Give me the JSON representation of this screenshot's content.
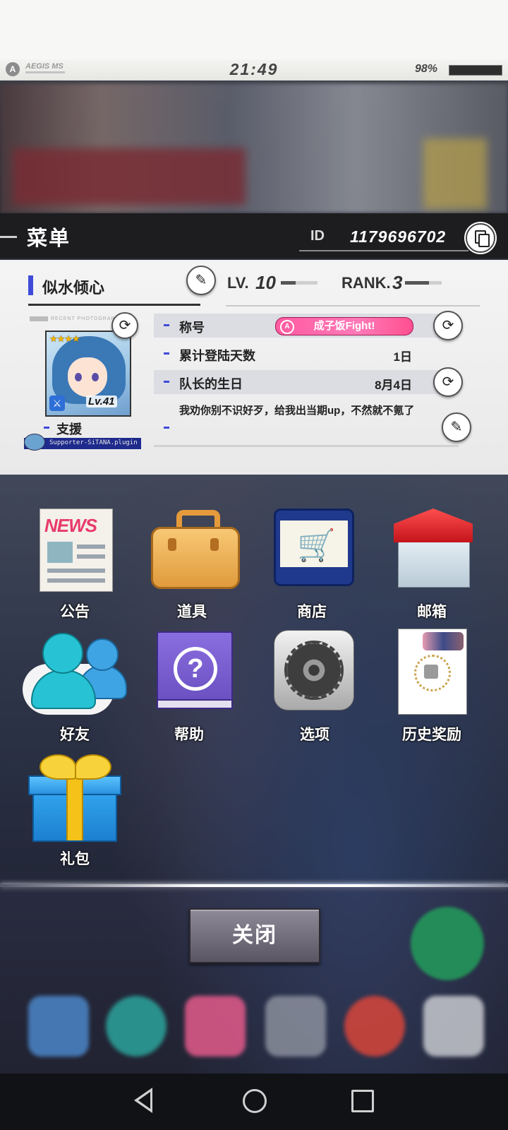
{
  "status_bar": {
    "brand": "AEGIS MS",
    "clock": "21:49",
    "battery": "98%"
  },
  "header": {
    "title": "菜单",
    "id_label": "ID",
    "id_value": "1179696702"
  },
  "profile": {
    "player_name": "似水倾心",
    "lv_label": "LV.",
    "lv_value": "10",
    "rank_label": "RANK.",
    "rank_value": "3",
    "recent_label": "RECENT PHOTOGRAPH",
    "avatar_stars": "★★★★",
    "avatar_level": "Lv.41",
    "support_label": "支援",
    "plugin_text": "Supporter-SiTANA.plugin",
    "rows": [
      {
        "label": "称号",
        "badge": "成子饭Fight!"
      },
      {
        "label": "累计登陆天数",
        "value": "1日"
      },
      {
        "label": "队长的生日",
        "value": "8月4日"
      }
    ],
    "message": "我劝你别不识好歹，给我出当期up，不然就不氪了"
  },
  "menu": {
    "items": [
      {
        "label": "公告",
        "icon": "news-icon"
      },
      {
        "label": "道具",
        "icon": "briefcase-icon"
      },
      {
        "label": "商店",
        "icon": "shopping-cart-icon"
      },
      {
        "label": "邮箱",
        "icon": "mailbox-icon"
      },
      {
        "label": "好友",
        "icon": "friends-icon"
      },
      {
        "label": "帮助",
        "icon": "help-book-icon"
      },
      {
        "label": "选项",
        "icon": "gear-icon"
      },
      {
        "label": "历史奖励",
        "icon": "history-rewards-icon"
      },
      {
        "label": "礼包",
        "icon": "gift-box-icon"
      }
    ],
    "news_icon_text": "NEWS"
  },
  "close_button": "关闭",
  "colors": {
    "accent_blue": "#3f4bd8",
    "badge_pink": "#ff5aa0",
    "header_dark": "#1d1d20"
  },
  "progress": {
    "lv_bar_fraction": 0.4,
    "rank_bar_fraction": 0.65
  }
}
